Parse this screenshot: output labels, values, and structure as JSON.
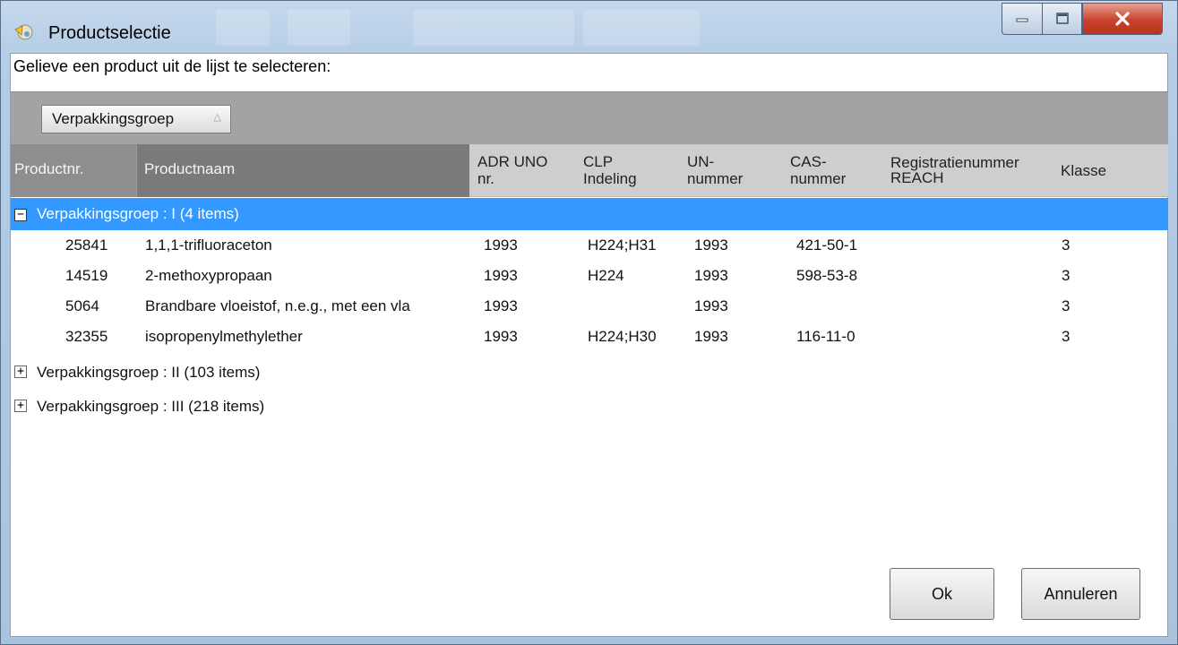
{
  "window": {
    "title": "Productselectie",
    "controls": [
      "minimize-icon",
      "maximize-icon",
      "close-icon"
    ]
  },
  "prompt": "Gelieve een product uit de lijst te selecteren:",
  "group_panel": {
    "chip_label": "Verpakkingsgroep",
    "sort_indicator": "sort-ascending-icon"
  },
  "columns": {
    "productnr": "Productnr.",
    "productnaam": "Productnaam",
    "adr_line1": "ADR UNO",
    "adr_line2": "nr.",
    "clp_line1": "CLP",
    "clp_line2": "Indeling",
    "un_line1": "UN-",
    "un_line2": "nummer",
    "cas_line1": "CAS-",
    "cas_line2": "nummer",
    "reach_line1": "Registratienummer",
    "reach_line2": "REACH",
    "klasse": "Klasse"
  },
  "groups": [
    {
      "label": "Verpakkingsgroep : I (4 items)",
      "expanded": true,
      "selected": true,
      "rows": [
        {
          "nr": "25841",
          "naam": "1,1,1-trifluoraceton",
          "adr": "1993",
          "clp": "H224;H31",
          "un": "1993",
          "cas": "421-50-1",
          "reach": "",
          "klasse": "3"
        },
        {
          "nr": "14519",
          "naam": "2-methoxypropaan",
          "adr": "1993",
          "clp": "H224",
          "un": "1993",
          "cas": "598-53-8",
          "reach": "",
          "klasse": "3"
        },
        {
          "nr": "5064",
          "naam": "Brandbare vloeistof, n.e.g., met een vla",
          "adr": "1993",
          "clp": "",
          "un": "1993",
          "cas": "",
          "reach": "",
          "klasse": "3"
        },
        {
          "nr": "32355",
          "naam": "isopropenylmethylether",
          "adr": "1993",
          "clp": "H224;H30",
          "un": "1993",
          "cas": "116-11-0",
          "reach": "",
          "klasse": "3"
        }
      ]
    },
    {
      "label": "Verpakkingsgroep : II (103 items)",
      "expanded": false
    },
    {
      "label": "Verpakkingsgroep : III (218 items)",
      "expanded": false
    }
  ],
  "expander": {
    "collapse": "−",
    "expand": "+"
  },
  "buttons": {
    "ok": "Ok",
    "cancel": "Annuleren"
  },
  "colors": {
    "selection": "#3399ff",
    "group_panel": "#a3a3a3",
    "close_button": "#c9422c"
  }
}
